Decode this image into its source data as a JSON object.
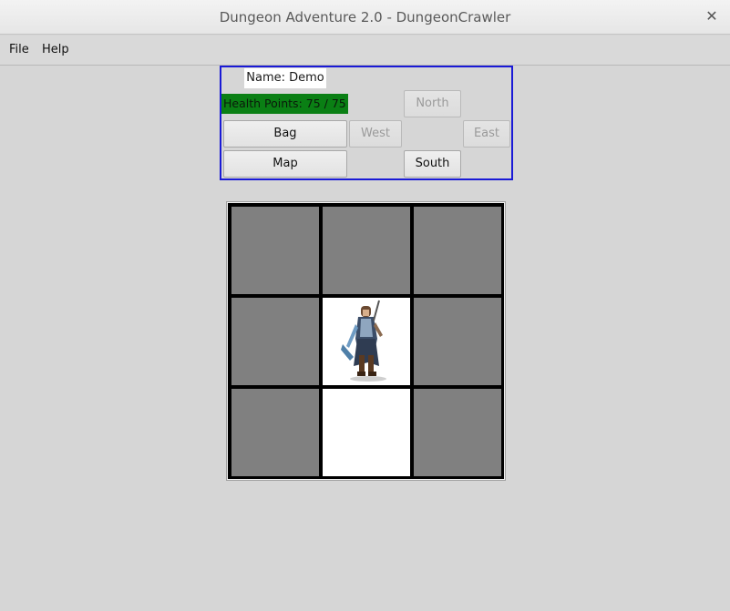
{
  "window": {
    "title": "Dungeon Adventure 2.0 - DungeonCrawler",
    "close_icon": "close-icon"
  },
  "menu": {
    "items": [
      "File",
      "Help"
    ]
  },
  "player": {
    "name_label": "Name: Demo",
    "health_label": "Health Points: 75 / 75",
    "health_fraction": 1.0,
    "health_color": "#0a7f14"
  },
  "buttons": {
    "north": "North",
    "west": "West",
    "east": "East",
    "south": "South",
    "bag": "Bag",
    "map": "Map"
  },
  "directions_enabled": {
    "north": false,
    "west": false,
    "east": false,
    "south": true
  },
  "colors": {
    "panel_border": "#1a1ad6",
    "unexplored": "#808080",
    "explored": "#ffffff",
    "wall": "#000000"
  },
  "map": {
    "rows": 3,
    "cols": 3,
    "cells": [
      [
        "unexplored",
        "unexplored",
        "unexplored"
      ],
      [
        "unexplored",
        "player",
        "unexplored"
      ],
      [
        "unexplored",
        "explored",
        "unexplored"
      ]
    ]
  }
}
